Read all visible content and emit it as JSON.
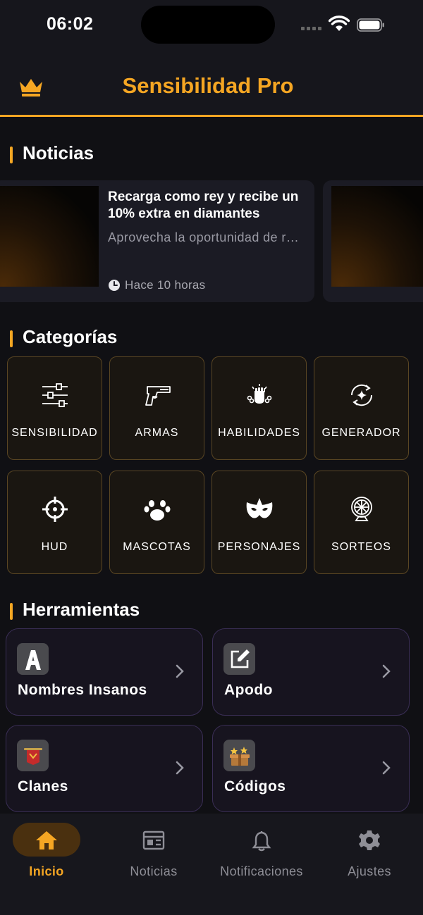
{
  "status_bar": {
    "time": "06:02"
  },
  "header": {
    "title": "Sensibilidad Pro",
    "accent": "#f5a623"
  },
  "sections": {
    "news": "Noticias",
    "categories": "Categorías",
    "tools": "Herramientas"
  },
  "news": [
    {
      "title": "Recarga como rey y recibe un 10% extra en diamantes",
      "description": "Aprovecha la oportunidad de recargar",
      "time": "Hace 10 horas"
    }
  ],
  "categories": [
    {
      "label": "SENSIBILIDAD",
      "icon": "sliders-icon"
    },
    {
      "label": "ARMAS",
      "icon": "pistol-icon"
    },
    {
      "label": "HABILIDADES",
      "icon": "fist-chain-icon"
    },
    {
      "label": "GENERADOR",
      "icon": "refresh-sparkle-icon"
    },
    {
      "label": "HUD",
      "icon": "crosshair-icon"
    },
    {
      "label": "MASCOTAS",
      "icon": "paw-icon"
    },
    {
      "label": "PERSONAJES",
      "icon": "mask-icon"
    },
    {
      "label": "SORTEOS",
      "icon": "wheel-icon"
    }
  ],
  "tools": [
    {
      "label": "Nombres Insanos",
      "icon": "letter-a-icon"
    },
    {
      "label": "Apodo",
      "icon": "edit-icon"
    },
    {
      "label": "Clanes",
      "icon": "banner-icon"
    },
    {
      "label": "Códigos",
      "icon": "gift-box-icon"
    }
  ],
  "nav": [
    {
      "label": "Inicio",
      "icon": "home-icon",
      "active": true
    },
    {
      "label": "Noticias",
      "icon": "newspaper-icon"
    },
    {
      "label": "Notificaciones",
      "icon": "bell-icon"
    },
    {
      "label": "Ajustes",
      "icon": "gear-icon"
    }
  ]
}
